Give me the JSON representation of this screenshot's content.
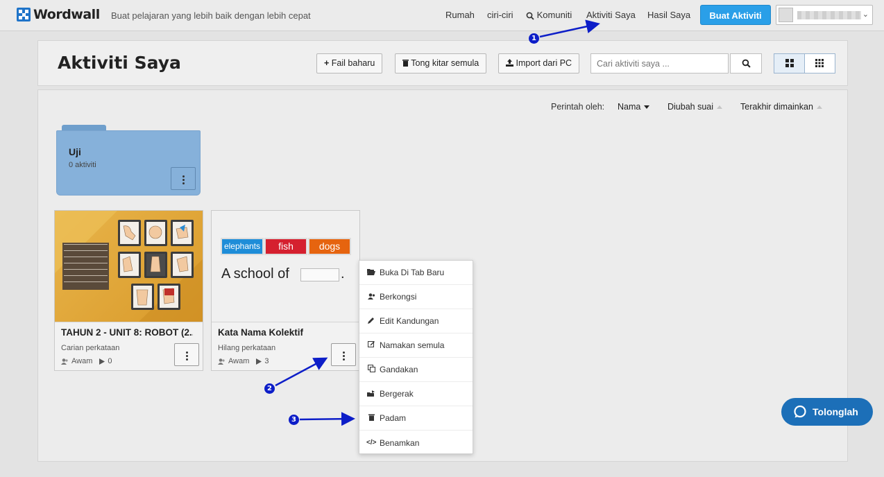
{
  "topbar": {
    "logo_text": "Wordwall",
    "tagline": "Buat pelajaran yang lebih baik dengan lebih cepat",
    "nav": {
      "home": "Rumah",
      "features": "ciri-ciri",
      "community": "Komuniti",
      "my_activities": "Aktiviti Saya",
      "my_results": "Hasil Saya"
    },
    "create_label": "Buat Aktiviti"
  },
  "header": {
    "title": "Aktiviti Saya",
    "new_folder_label": "Fail baharu",
    "recycle_label": "Tong kitar semula",
    "import_label": "Import dari PC",
    "search_placeholder": "Cari aktiviti saya ..."
  },
  "sort": {
    "label": "Perintah oleh:",
    "options": [
      "Nama",
      "Diubah suai",
      "Terakhir dimainkan"
    ],
    "active": "Nama"
  },
  "folder": {
    "name": "Uji",
    "count": "0 aktiviti"
  },
  "cards": [
    {
      "title": "TAHUN 2 - UNIT 8: ROBOT (2...",
      "type": "Carian perkataan",
      "visibility": "Awam",
      "plays": "0"
    },
    {
      "title": "Kata Nama Kolektif",
      "type": "Hilang perkataan",
      "visibility": "Awam",
      "plays": "3",
      "thumb_words": [
        "elephants",
        "fish",
        "dogs"
      ],
      "thumb_sentence_start": "A school of",
      "thumb_sentence_end": "."
    }
  ],
  "context_menu": [
    {
      "label": "Buka Di Tab Baru",
      "icon": "folder-open-icon"
    },
    {
      "label": "Berkongsi",
      "icon": "user-share-icon"
    },
    {
      "label": "Edit Kandungan",
      "icon": "pencil-icon"
    },
    {
      "label": "Namakan semula",
      "icon": "edit-box-icon"
    },
    {
      "label": "Gandakan",
      "icon": "copy-icon"
    },
    {
      "label": "Bergerak",
      "icon": "move-icon"
    },
    {
      "label": "Padam",
      "icon": "trash-icon"
    },
    {
      "label": "Benamkan",
      "icon": "code-icon"
    }
  ],
  "help_label": "Tolonglah",
  "markers": [
    "1",
    "2",
    "3"
  ],
  "colors": {
    "brand_blue": "#1f74c9",
    "create_button": "#2a9fe8",
    "folder": "#86b1da",
    "help_button": "#1c6fb8",
    "annotation": "#0d1ec8"
  }
}
